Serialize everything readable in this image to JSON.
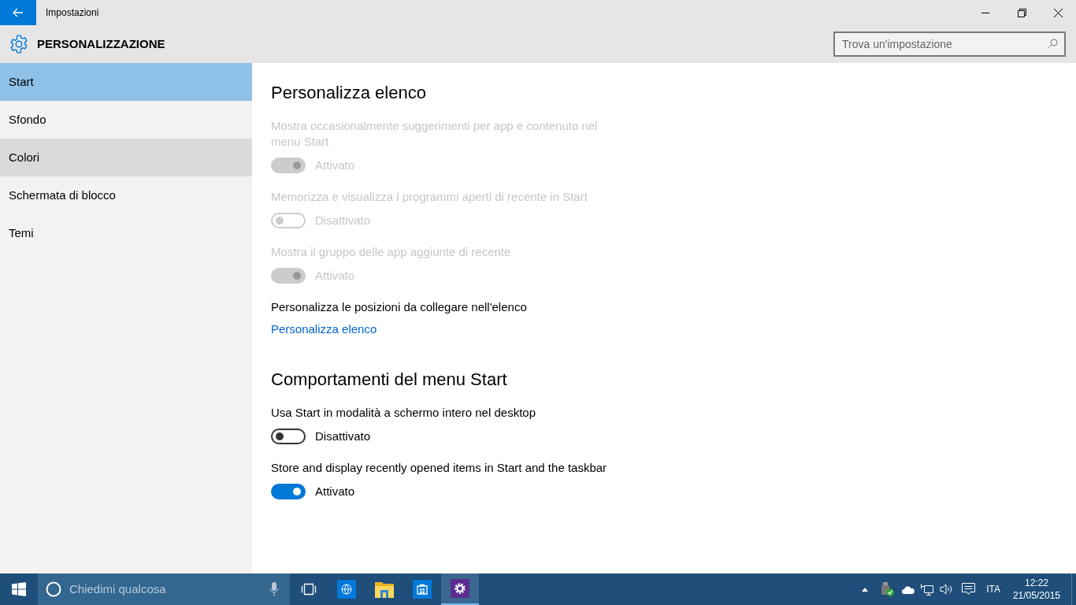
{
  "window": {
    "title": "Impostazioni",
    "header": "PERSONALIZZAZIONE",
    "search": {
      "placeholder": "Trova un'impostazione"
    }
  },
  "sidebar": {
    "items": [
      {
        "label": "Start",
        "selected": true,
        "hovered": false
      },
      {
        "label": "Sfondo",
        "selected": false,
        "hovered": false
      },
      {
        "label": "Colori",
        "selected": false,
        "hovered": true
      },
      {
        "label": "Schermata di blocco",
        "selected": false,
        "hovered": false
      },
      {
        "label": "Temi",
        "selected": false,
        "hovered": false
      }
    ]
  },
  "sections": [
    {
      "title": "Personalizza elenco",
      "items": [
        {
          "kind": "toggle",
          "label": "Mostra occasionalmente suggerimenti per app e contenuto nel menu Start",
          "on": true,
          "disabled": true,
          "state_text": "Attivato"
        },
        {
          "kind": "toggle",
          "label": "Memorizza e visualizza i programmi aperti di recente in Start",
          "on": false,
          "disabled": true,
          "state_text": "Disattivato"
        },
        {
          "kind": "toggle",
          "label": "Mostra il gruppo delle app aggiunte di recente",
          "on": true,
          "disabled": true,
          "state_text": "Attivato"
        },
        {
          "kind": "text",
          "text": "Personalizza le posizioni da collegare nell'elenco"
        },
        {
          "kind": "link",
          "text": "Personalizza elenco"
        }
      ]
    },
    {
      "title": "Comportamenti del menu Start",
      "items": [
        {
          "kind": "toggle",
          "label": "Usa Start in modalità a schermo intero nel desktop",
          "on": false,
          "disabled": false,
          "state_text": "Disattivato"
        },
        {
          "kind": "toggle",
          "label": "Store and display recently opened items in Start and the taskbar",
          "on": true,
          "disabled": false,
          "state_text": "Attivato"
        }
      ]
    }
  ],
  "taskbar": {
    "search_placeholder": "Chiedimi qualcosa",
    "apps": [
      {
        "kind": "taskview",
        "selected": false
      },
      {
        "kind": "browser",
        "selected": false
      },
      {
        "kind": "explorer",
        "selected": false
      },
      {
        "kind": "store",
        "selected": false
      },
      {
        "kind": "settings",
        "selected": true
      }
    ],
    "language": "ITA",
    "time": "12:22",
    "date": "21/05/2015"
  }
}
